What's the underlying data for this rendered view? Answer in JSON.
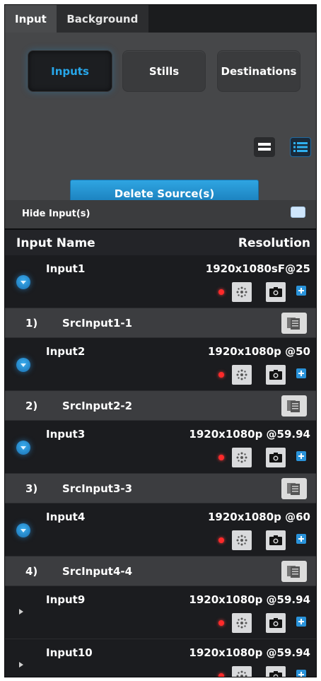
{
  "tabs": [
    {
      "label": "Input",
      "active": true
    },
    {
      "label": "Background",
      "active": false
    }
  ],
  "segments": [
    {
      "label": "Inputs",
      "active": true
    },
    {
      "label": "Stills",
      "active": false
    },
    {
      "label": "Destinations",
      "active": false
    }
  ],
  "view_buttons": [
    {
      "icon": "compact-view-icon",
      "active": false
    },
    {
      "icon": "list-view-icon",
      "active": true
    }
  ],
  "delete_button": {
    "label": "Delete Source(s)"
  },
  "hide_inputs": {
    "label": "Hide Input(s)",
    "checked": false
  },
  "columns": {
    "name": "Input Name",
    "resolution": "Resolution"
  },
  "rows": [
    {
      "type": "input",
      "name": "Input1",
      "resolution": "1920x1080sF@25",
      "expanded": true
    },
    {
      "type": "source",
      "number": "1)",
      "name": "SrcInput1-1"
    },
    {
      "type": "input",
      "name": "Input2",
      "resolution": "1920x1080p @50",
      "expanded": true
    },
    {
      "type": "source",
      "number": "2)",
      "name": "SrcInput2-2"
    },
    {
      "type": "input",
      "name": "Input3",
      "resolution": "1920x1080p @59.94",
      "expanded": true
    },
    {
      "type": "source",
      "number": "3)",
      "name": "SrcInput3-3"
    },
    {
      "type": "input",
      "name": "Input4",
      "resolution": "1920x1080p @60",
      "expanded": true
    },
    {
      "type": "source",
      "number": "4)",
      "name": "SrcInput4-4"
    },
    {
      "type": "input",
      "name": "Input9",
      "resolution": "1920x1080p @59.94",
      "expanded": false
    },
    {
      "type": "input",
      "name": "Input10",
      "resolution": "1920x1080p @59.94",
      "expanded": false
    }
  ],
  "colors": {
    "accent": "#27a7ea",
    "record": "#ff2a2a",
    "button_blue": "#2a93da"
  }
}
